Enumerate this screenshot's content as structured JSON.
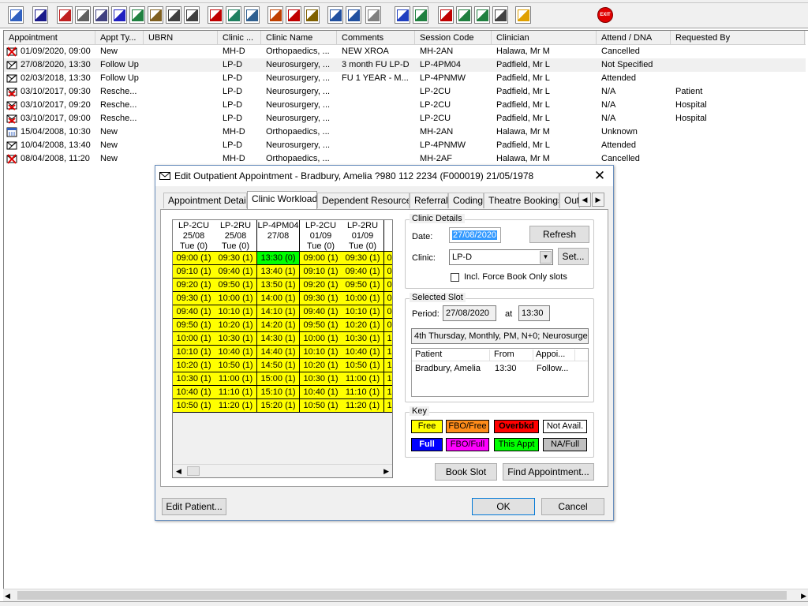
{
  "colors": {
    "free": "#ffff00",
    "fbo_free": "#ff8c1a",
    "overbooked": "#ff0000",
    "not_avail": "#ffffff",
    "full": "#0000ff",
    "fbo_full": "#ff00ff",
    "this_appt": "#00ff00",
    "na_full": "#c0c0c0"
  },
  "toolbar": {
    "icons": [
      "user-icon",
      "printer-icon",
      "books-icon",
      "edit-icon",
      "grid-icon",
      "m-letter-icon",
      "person-icon",
      "notes-icon",
      "mail-icon",
      "envelope-icon",
      "clock-icon",
      "monitor-icon",
      "calendar-icon",
      "document-icon",
      "clock-edit-icon",
      "list-icon",
      "vehicle-icon",
      "upload-icon",
      "page-icon",
      "chart-icon",
      "globe-icon",
      "forms-icon",
      "check-icon",
      "move-icon",
      "swap-icon",
      "warning-icon",
      "exit-icon"
    ]
  },
  "exit_label": "EXIT",
  "list": {
    "columns": [
      "Appointment",
      "Appt Ty...",
      "UBRN",
      "Clinic ...",
      "Clinic Name",
      "Comments",
      "Session Code",
      "Clinician",
      "Attend / DNA",
      "Requested By"
    ],
    "rows": [
      {
        "icon": "cancelled-appointment-icon",
        "appointment": "01/09/2020, 09:00",
        "type": "New",
        "ubrn": "",
        "clinic": "MH-D",
        "clinic_name": "Orthopaedics, ...",
        "comments": "NEW XROA",
        "session": "MH-2AN",
        "clinician": "Halawa, Mr M",
        "attend": "Cancelled",
        "requested": ""
      },
      {
        "icon": "appointment-icon",
        "appointment": "27/08/2020, 13:30",
        "type": "Follow Up",
        "ubrn": "",
        "clinic": "LP-D",
        "clinic_name": "Neurosurgery, ...",
        "comments": "3 month FU LP-D",
        "session": "LP-4PM04",
        "clinician": "Padfield, Mr L",
        "attend": "Not Specified",
        "requested": ""
      },
      {
        "icon": "appointment-icon",
        "appointment": "02/03/2018, 13:30",
        "type": "Follow Up",
        "ubrn": "",
        "clinic": "LP-D",
        "clinic_name": "Neurosurgery, ...",
        "comments": "FU 1 YEAR - M...",
        "session": "LP-4PNMW",
        "clinician": "Padfield, Mr L",
        "attend": "Attended",
        "requested": ""
      },
      {
        "icon": "rescheduled-appointment-icon",
        "appointment": "03/10/2017, 09:30",
        "type": "Resche...",
        "ubrn": "",
        "clinic": "LP-D",
        "clinic_name": "Neurosurgery, ...",
        "comments": "",
        "session": "LP-2CU",
        "clinician": "Padfield, Mr L",
        "attend": "N/A",
        "requested": "Patient"
      },
      {
        "icon": "rescheduled-appointment-icon",
        "appointment": "03/10/2017, 09:20",
        "type": "Resche...",
        "ubrn": "",
        "clinic": "LP-D",
        "clinic_name": "Neurosurgery, ...",
        "comments": "",
        "session": "LP-2CU",
        "clinician": "Padfield, Mr L",
        "attend": "N/A",
        "requested": "Hospital"
      },
      {
        "icon": "rescheduled-appointment-icon",
        "appointment": "03/10/2017, 09:00",
        "type": "Resche...",
        "ubrn": "",
        "clinic": "LP-D",
        "clinic_name": "Neurosurgery, ...",
        "comments": "",
        "session": "LP-2CU",
        "clinician": "Padfield, Mr L",
        "attend": "N/A",
        "requested": "Hospital"
      },
      {
        "icon": "calendar-appointment-icon",
        "appointment": "15/04/2008, 10:30",
        "type": "New",
        "ubrn": "",
        "clinic": "MH-D",
        "clinic_name": "Orthopaedics, ...",
        "comments": "",
        "session": "MH-2AN",
        "clinician": "Halawa, Mr M",
        "attend": "Unknown",
        "requested": ""
      },
      {
        "icon": "appointment-icon",
        "appointment": "10/04/2008, 13:40",
        "type": "New",
        "ubrn": "",
        "clinic": "LP-D",
        "clinic_name": "Neurosurgery, ...",
        "comments": "",
        "session": "LP-4PNMW",
        "clinician": "Padfield, Mr L",
        "attend": "Attended",
        "requested": ""
      },
      {
        "icon": "cancelled-appointment-icon",
        "appointment": "08/04/2008, 11:20",
        "type": "New",
        "ubrn": "",
        "clinic": "MH-D",
        "clinic_name": "Orthopaedics, ...",
        "comments": "",
        "session": "MH-2AF",
        "clinician": "Halawa, Mr M",
        "attend": "Cancelled",
        "requested": ""
      }
    ]
  },
  "dialog": {
    "title": "Edit Outpatient Appointment - Bradbury, Amelia ?980 112 2234 (F000019) 21/05/1978",
    "close": "✕",
    "tabs": [
      "Appointment Details",
      "Clinic Workload",
      "Dependent Resources",
      "Referral",
      "Coding",
      "Theatre Bookings",
      "Out"
    ],
    "active_tab": "Clinic Workload",
    "grid": {
      "columns": [
        {
          "code": "LP-2CU",
          "date": "25/08",
          "day": "Tue  (0)",
          "slots": [
            "09:00 (1)",
            "09:10 (1)",
            "09:20 (1)",
            "09:30 (1)",
            "09:40 (1)",
            "09:50 (1)",
            "10:00 (1)",
            "10:10 (1)",
            "10:20 (1)",
            "10:30 (1)",
            "10:40 (1)",
            "10:50 (1)"
          ]
        },
        {
          "code": "LP-2RU",
          "date": "25/08",
          "day": "Tue  (0)",
          "slots": [
            "09:30 (1)",
            "09:40 (1)",
            "09:50 (1)",
            "10:00 (1)",
            "10:10 (1)",
            "10:20 (1)",
            "10:30 (1)",
            "10:40 (1)",
            "10:50 (1)",
            "11:00 (1)",
            "11:10 (1)",
            "11:20 (1)"
          ]
        },
        {
          "code": "LP-4PM04",
          "date": "27/08",
          "day": "",
          "slots": [
            "13:30 (0)",
            "13:40 (1)",
            "13:50 (1)",
            "14:00 (1)",
            "14:10 (1)",
            "14:20 (1)",
            "14:30 (1)",
            "14:40 (1)",
            "14:50 (1)",
            "15:00 (1)",
            "15:10 (1)",
            "15:20 (1)"
          ]
        },
        {
          "code": "LP-2CU",
          "date": "01/09",
          "day": "Tue  (0)",
          "slots": [
            "09:00 (1)",
            "09:10 (1)",
            "09:20 (1)",
            "09:30 (1)",
            "09:40 (1)",
            "09:50 (1)",
            "10:00 (1)",
            "10:10 (1)",
            "10:20 (1)",
            "10:30 (1)",
            "10:40 (1)",
            "10:50 (1)"
          ]
        },
        {
          "code": "LP-2RU",
          "date": "01/09",
          "day": "Tue  (0)",
          "slots": [
            "09:30 (1)",
            "09:40 (1)",
            "09:50 (1)",
            "10:00 (1)",
            "10:10 (1)",
            "10:20 (1)",
            "10:30 (1)",
            "10:40 (1)",
            "10:50 (1)",
            "11:00 (1)",
            "11:10 (1)",
            "11:20 (1)"
          ]
        },
        {
          "code": "",
          "date": "",
          "day": "",
          "slots": [
            "0",
            "0",
            "0",
            "0",
            "0",
            "0",
            "1",
            "1",
            "1",
            "1",
            "1",
            "1"
          ]
        }
      ],
      "selected": {
        "col": 2,
        "row": 0
      }
    },
    "clinic_details": {
      "label": "Clinic Details",
      "date_label": "Date:",
      "date": "27/08/2020",
      "refresh": "Refresh",
      "clinic_label": "Clinic:",
      "clinic": "LP-D",
      "set": "Set...",
      "force_book": "Incl. Force Book Only slots"
    },
    "selected_slot": {
      "label": "Selected Slot",
      "period_label": "Period:",
      "period": "27/08/2020",
      "at_label": "at",
      "time": "13:30",
      "description": "4th Thursday, Monthly, PM, N+0; Neurosurger",
      "columns": [
        "Patient",
        "From",
        "Appoi..."
      ],
      "rows": [
        {
          "patient": "Bradbury, Amelia",
          "from": "13:30",
          "appoi": "Follow..."
        }
      ]
    },
    "key": {
      "label": "Key",
      "items": [
        "Free",
        "FBO/Free",
        "Overbkd",
        "Not Avail.",
        "Full",
        "FBO/Full",
        "This Appt",
        "NA/Full"
      ]
    },
    "buttons": {
      "book_slot": "Book Slot",
      "find_appointment": "Find Appointment...",
      "edit_patient": "Edit Patient...",
      "ok": "OK",
      "cancel": "Cancel"
    }
  }
}
